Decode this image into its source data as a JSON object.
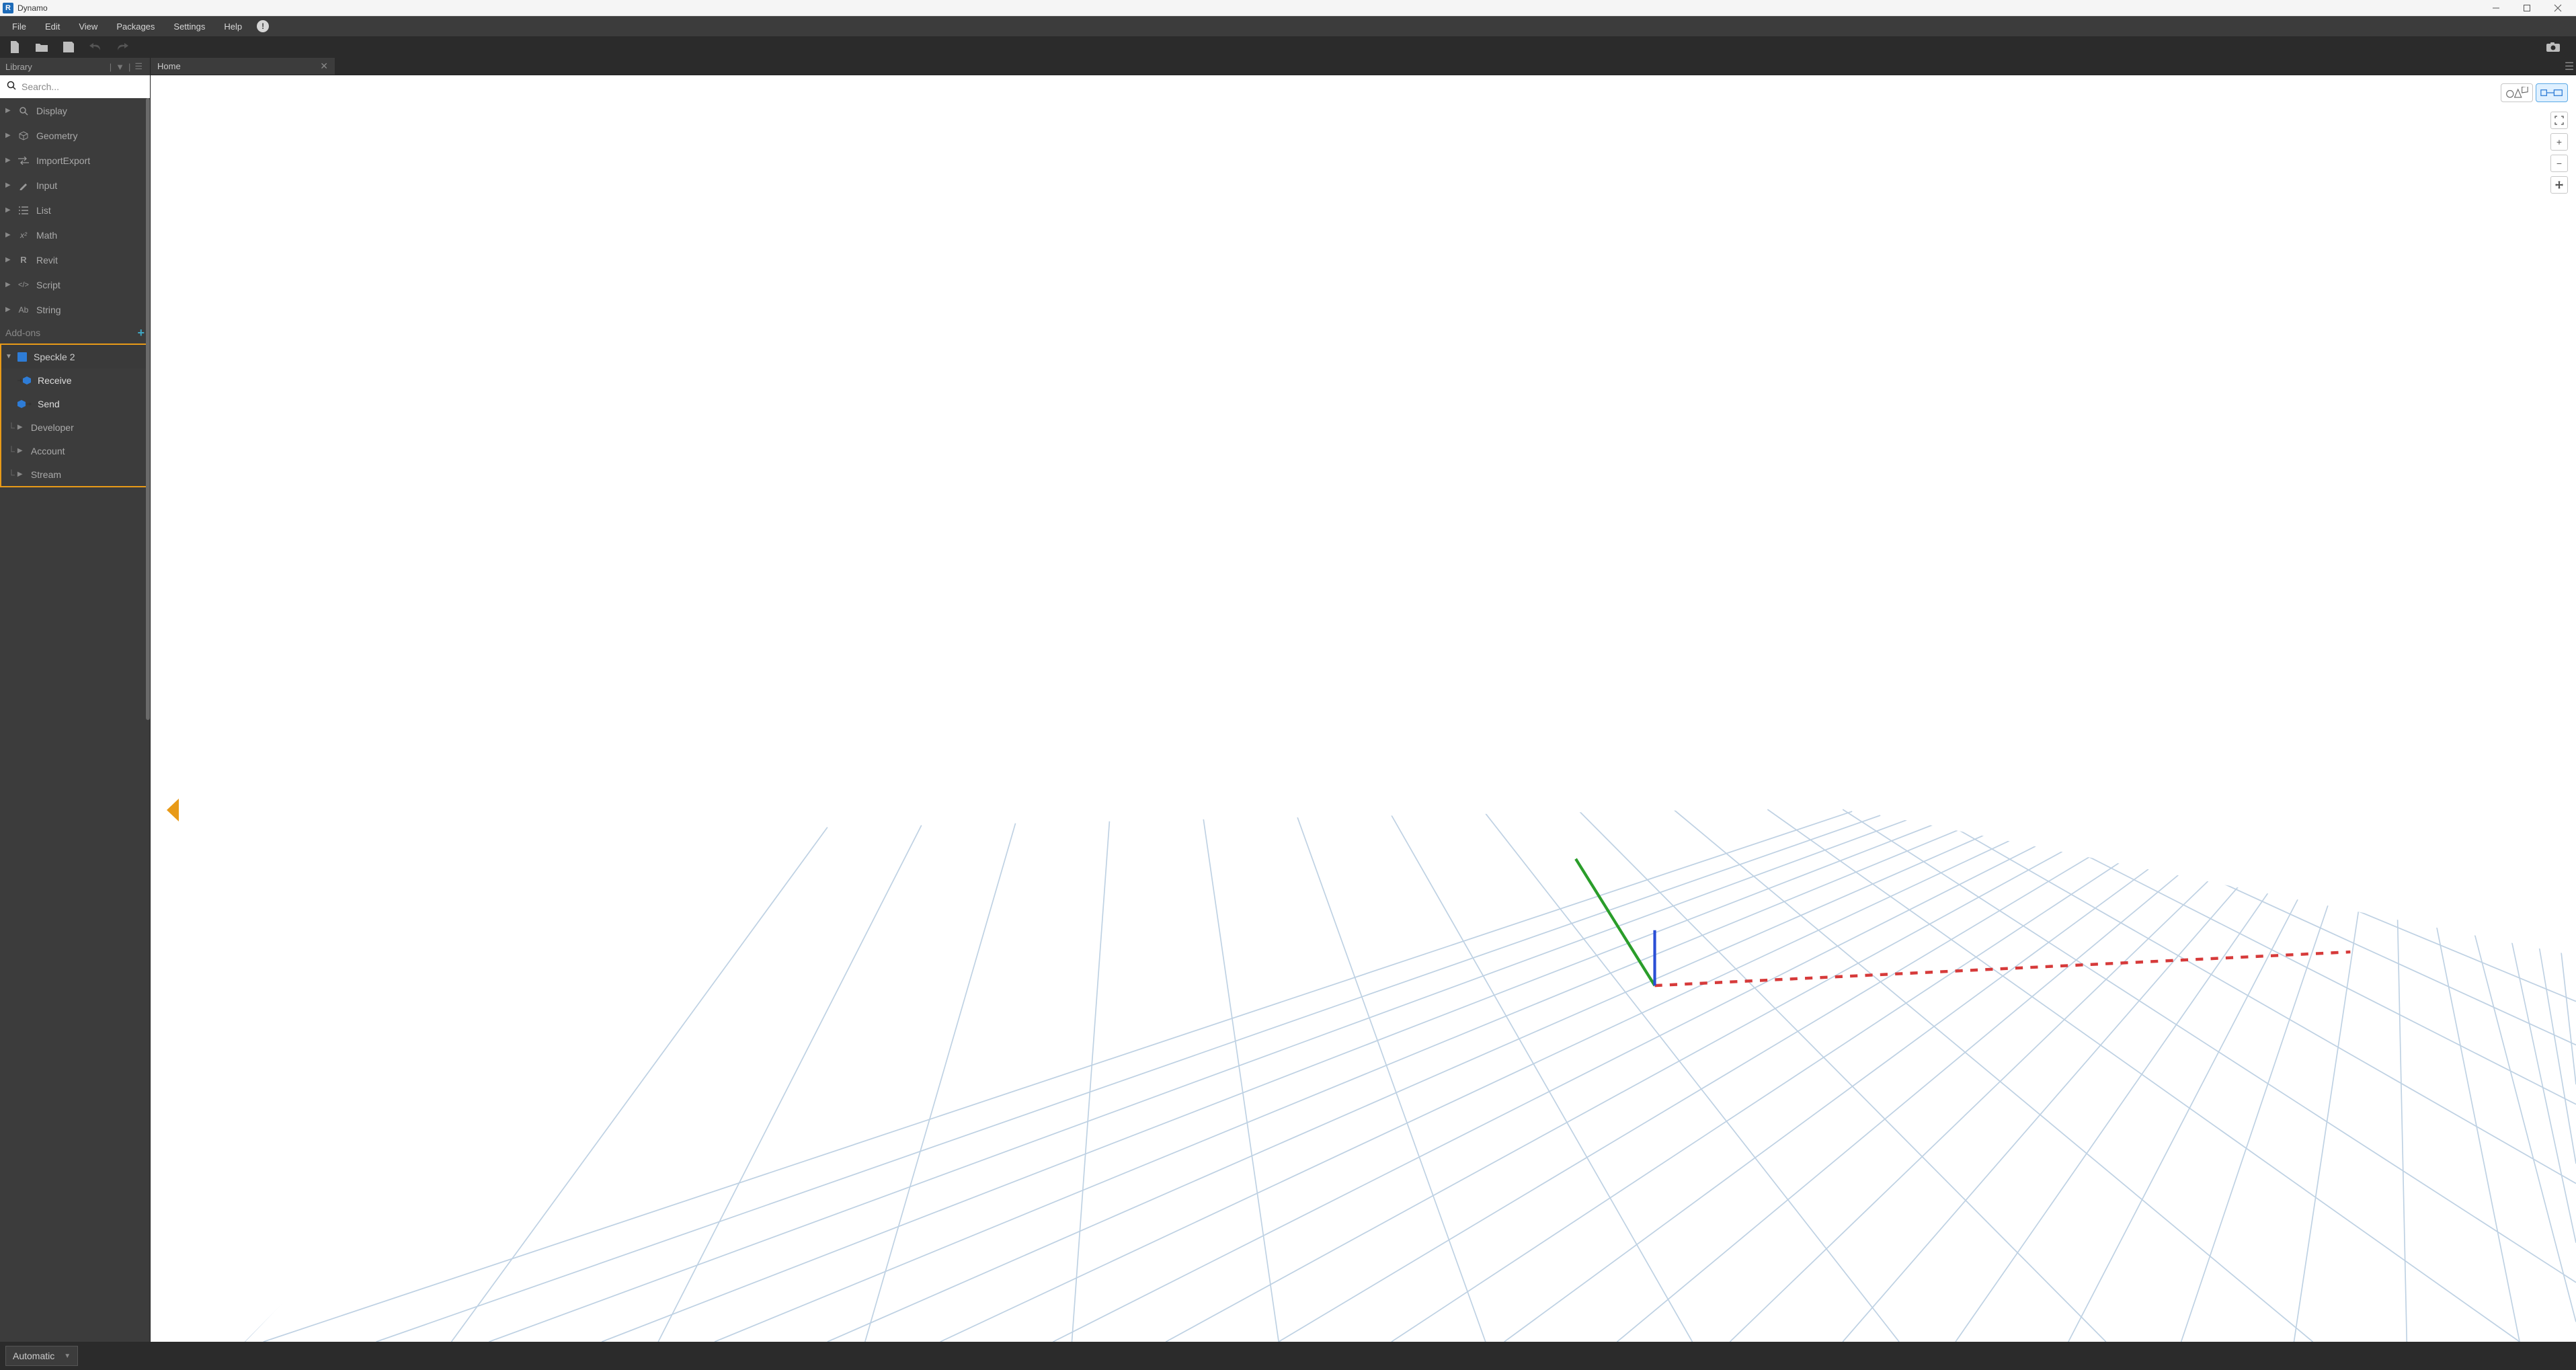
{
  "titlebar": {
    "app_letter": "R",
    "title": "Dynamo"
  },
  "menu": {
    "file": "File",
    "edit": "Edit",
    "view": "View",
    "packages": "Packages",
    "settings": "Settings",
    "help": "Help"
  },
  "library": {
    "title": "Library",
    "search_placeholder": "Search...",
    "items": [
      {
        "label": "Display"
      },
      {
        "label": "Geometry"
      },
      {
        "label": "ImportExport"
      },
      {
        "label": "Input"
      },
      {
        "label": "List"
      },
      {
        "label": "Math"
      },
      {
        "label": "Revit"
      },
      {
        "label": "Script"
      },
      {
        "label": "String"
      }
    ],
    "addons_title": "Add-ons",
    "speckle": {
      "label": "Speckle 2",
      "children": [
        {
          "label": "Receive"
        },
        {
          "label": "Send"
        }
      ],
      "subs": [
        {
          "label": "Developer"
        },
        {
          "label": "Account"
        },
        {
          "label": "Stream"
        }
      ]
    }
  },
  "tab": {
    "label": "Home"
  },
  "statusbar": {
    "run_mode": "Automatic"
  }
}
